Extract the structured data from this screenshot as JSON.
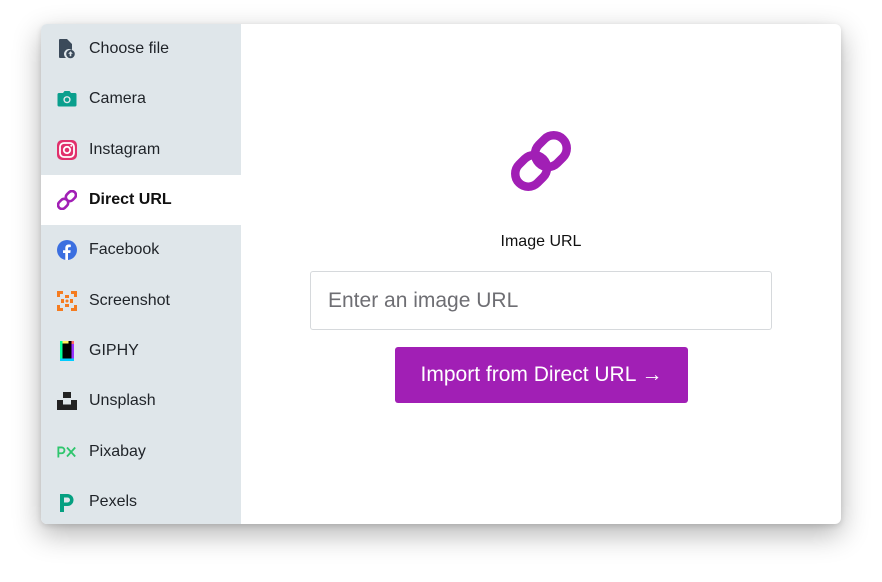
{
  "sidebar": {
    "items": [
      {
        "label": "Choose file",
        "icon": "file-upload-icon",
        "active": false
      },
      {
        "label": "Camera",
        "icon": "camera-icon",
        "active": false
      },
      {
        "label": "Instagram",
        "icon": "instagram-icon",
        "active": false
      },
      {
        "label": "Direct URL",
        "icon": "link-icon",
        "active": true
      },
      {
        "label": "Facebook",
        "icon": "facebook-icon",
        "active": false
      },
      {
        "label": "Screenshot",
        "icon": "screenshot-icon",
        "active": false
      },
      {
        "label": "GIPHY",
        "icon": "giphy-icon",
        "active": false
      },
      {
        "label": "Unsplash",
        "icon": "unsplash-icon",
        "active": false
      },
      {
        "label": "Pixabay",
        "icon": "pixabay-icon",
        "active": false
      },
      {
        "label": "Pexels",
        "icon": "pexels-icon",
        "active": false
      }
    ]
  },
  "main": {
    "icon": "link-icon",
    "field_label": "Image URL",
    "input_placeholder": "Enter an image URL",
    "input_value": "",
    "import_button_label": "Import from Direct URL →"
  },
  "colors": {
    "accent": "#a11fb5",
    "sidebar_bg": "#dfe6ea",
    "active_item_bg": "#ffffff"
  }
}
